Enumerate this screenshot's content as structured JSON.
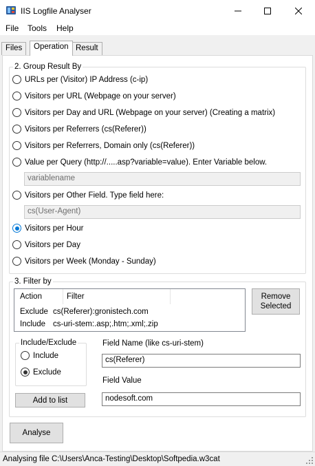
{
  "window": {
    "title": "IIS Logfile Analyser"
  },
  "menu": [
    "File",
    "Tools",
    "Help"
  ],
  "tabs": [
    "Files",
    "Operation",
    "Result"
  ],
  "group": {
    "legend": "2. Group Result By",
    "options": [
      "URLs per (Visitor) IP Address (c-ip)",
      "Visitors per URL (Webpage on your server)",
      "Visitors per Day and URL (Webpage on your server) (Creating a matrix)",
      "Visitors per Referrers (cs(Referer))",
      "Visitors per Referrers, Domain only (cs(Referer))",
      "Value per Query (http://.....asp?variable=value). Enter Variable below.",
      "Visitors per Other Field. Type field here:",
      "Visitors per Hour",
      "Visitors per Day",
      "Visitors per Week (Monday - Sunday)"
    ],
    "selected": "Visitors per Hour",
    "query_variable_value": "variablename",
    "other_field_value": "cs(User-Agent)"
  },
  "filter": {
    "legend": "3. Filter by",
    "columns": [
      "Action",
      "Filter"
    ],
    "rows": [
      {
        "action": "Exclude",
        "filter": "cs(Referer):gronistech.com"
      },
      {
        "action": "Include",
        "filter": "cs-uri-stem:.asp;.htm;.xml;.zip"
      }
    ],
    "remove_button": "Remove Selected",
    "include_exclude_legend": "Include/Exclude",
    "include_label": "Include",
    "exclude_label": "Exclude",
    "selected_mode": "Exclude",
    "field_name_label": "Field Name (like cs-uri-stem)",
    "field_name_value": "cs(Referer)",
    "field_value_label": "Field Value",
    "field_value_value": "nodesoft.com",
    "add_button": "Add to list"
  },
  "analyse_button": "Analyse",
  "status": "Analysing file C:\\Users\\Anca-Testing\\Desktop\\Softpedia.w3cat",
  "colors": {
    "accent": "#0078d7",
    "window_bg": "#f0f0f0",
    "panel_bg": "#ffffff"
  }
}
